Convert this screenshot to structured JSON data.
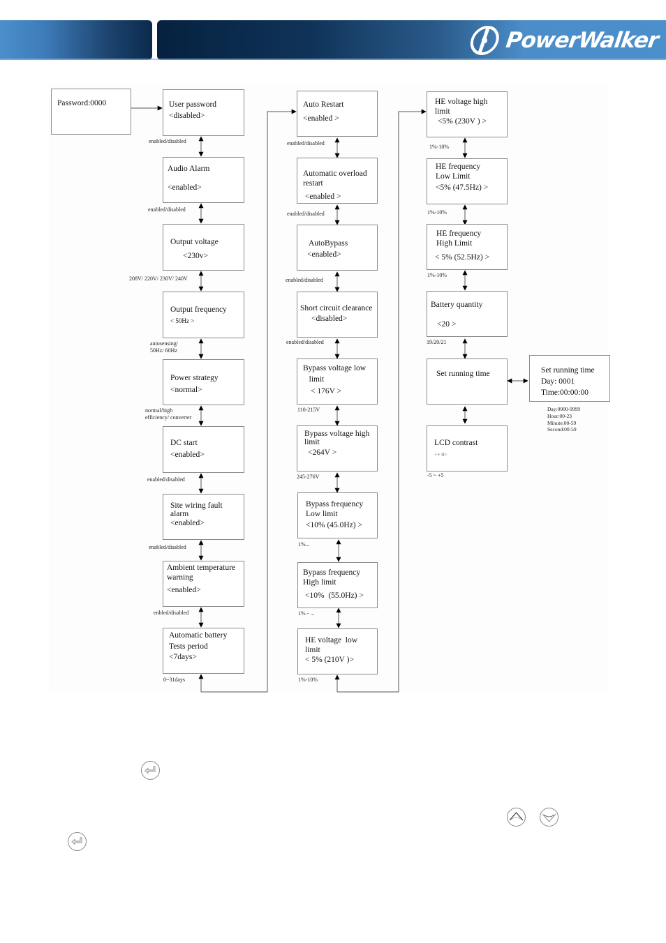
{
  "header": {
    "brand": "PowerWalker",
    "colors": {
      "dark": "#0b2a4c",
      "light": "#4b8fcb"
    }
  },
  "password_box": {
    "text": "Password:0000"
  },
  "column1": [
    {
      "title": "User password",
      "value": "<disabled>",
      "range": "enabled/disabled"
    },
    {
      "title": "Audio Alarm",
      "value": "<enabled>",
      "range": "enabled/disabled"
    },
    {
      "title": "Output voltage",
      "value": "<230v>",
      "range": "208V/ 220V/ 230V/ 240V"
    },
    {
      "title": "Output frequency",
      "value": "< 50Hz >",
      "range": "autosensing/\n50Hz/ 60Hz"
    },
    {
      "title": "Power strategy",
      "value": "<normal>",
      "range": "normal/high\nefficiency/ converter"
    },
    {
      "title": "DC start",
      "value": "<enabled>",
      "range": "enabled/disabled"
    },
    {
      "title": "Site wiring fault\nalarm",
      "value": "<enabled>",
      "range": "enabled/disabled"
    },
    {
      "title": "Ambient temperature\nwarning",
      "value": "<enabled>",
      "range": "enbled/disabled"
    },
    {
      "title": "Automatic battery\nTests period",
      "value": "<7days>",
      "range": "0~31days"
    }
  ],
  "column2": [
    {
      "title": "Auto Restart",
      "value": "<enabled >",
      "range": "enabled/disabled"
    },
    {
      "title": "Automatic overload\nrestart",
      "value": " <enabled >",
      "range": "enabled/disabled"
    },
    {
      "title": "AutoBypass",
      "value": "<enabled>",
      "range": "enabled/disabled"
    },
    {
      "title": "Short circuit clearance",
      "value": "<disabled>",
      "range": "enabled/disabled"
    },
    {
      "title": "Bypass voltage low\n   limit",
      "value": "< 176V >",
      "range": "110-215V"
    },
    {
      "title": "Bypass voltage high\nlimit",
      "value": "<264V >",
      "range": "245-276V"
    },
    {
      "title": "Bypass frequency\nLow limit",
      "value": "<10% (45.0Hz) >",
      "range": "1%..."
    },
    {
      "title": "Bypass frequency\nHigh limit",
      "value": "<10%  (55.0Hz) >",
      "range": "1% - ..."
    },
    {
      "title": "HE voltage  low\nlimit",
      "value": "< 5% (210V )>",
      "range": "1%-10%"
    }
  ],
  "column3": [
    {
      "title": "HE voltage high\nlimit",
      "value": "<5% (230V ) >",
      "range": "1%-10%"
    },
    {
      "title": "HE frequency\nLow Limit",
      "value": "<5% (47.5Hz) >",
      "range": "1%-10%"
    },
    {
      "title": "HE frequency\nHigh Limit",
      "value": "< 5% (52.5Hz) >",
      "range": "1%-10%"
    },
    {
      "title": "Battery quantity",
      "value": "<20 >",
      "range": "19/20/21"
    },
    {
      "title": "Set running time",
      "value": "",
      "range": ""
    },
    {
      "title": "LCD contrast",
      "value": "<+ 0>",
      "range": "-5 ~ +5"
    }
  ],
  "running_time_detail": {
    "title": "Set running time",
    "day": "Day: 0001",
    "time": "Time:00:00:00",
    "ranges": "Day:0000-9999\nHour:00-23\nMinute:00-59\nSecond:00-59"
  },
  "footer_icons": [
    "enter-icon",
    "enter-icon",
    "up-icon",
    "down-icon"
  ]
}
